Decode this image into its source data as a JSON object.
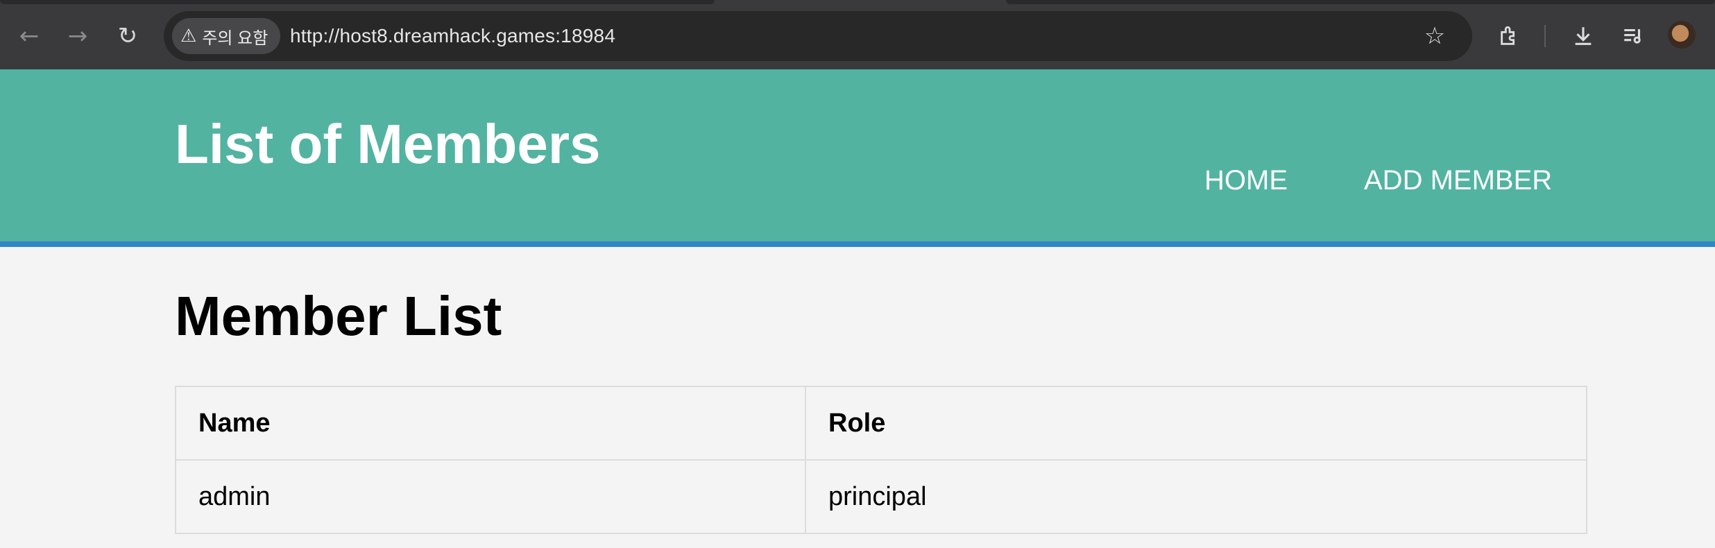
{
  "browser": {
    "security_chip": "주의 요함",
    "url": "http://host8.dreamhack.games:18984",
    "icons": [
      "back-arrow-icon",
      "forward-arrow-icon",
      "reload-icon",
      "warning-icon",
      "bookmark-star-icon",
      "extensions-icon",
      "download-icon",
      "media-queue-icon",
      "profile-avatar-icon"
    ]
  },
  "header": {
    "title": "List of Members",
    "nav": [
      {
        "label": "HOME"
      },
      {
        "label": "ADD MEMBER"
      }
    ],
    "background_color": "#52b3a1",
    "border_color": "#2e86c8"
  },
  "main": {
    "title": "Member List",
    "table": {
      "columns": [
        "Name",
        "Role"
      ],
      "rows": [
        [
          "admin",
          "principal"
        ]
      ]
    }
  }
}
